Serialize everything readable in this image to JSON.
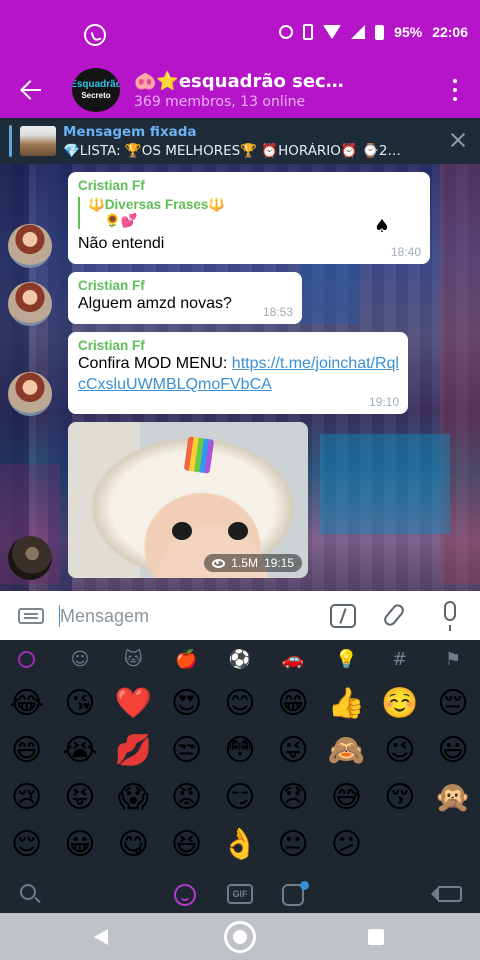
{
  "status_bar": {
    "battery": "95%",
    "time": "22:06"
  },
  "chat": {
    "title": "🐽⭐esquadrão sec…",
    "subtitle": "369 membros, 13 online",
    "avatar_line1": "Esquadrão",
    "avatar_line2": "Secreto"
  },
  "pinned": {
    "title": "Mensagem fixada",
    "text": "💎LISTA: 🏆OS MELHORES🏆 ⏰HORÁRIO⏰ ⌚2…"
  },
  "messages": [
    {
      "sender": "Cristian Ff",
      "reply_name": "🔱Diversas Frases🔱",
      "reply_text": "🌻💕",
      "text": "Não entendi",
      "time": "18:40"
    },
    {
      "sender": "Cristian Ff",
      "text": "Alguem amzd novas?",
      "time": "18:53"
    },
    {
      "sender": "Cristian Ff",
      "text": "Confira MOD MENU: ",
      "link": "https://t.me/joinchat/RqlcCxsluUWMBLQmoFVbCA",
      "time": "19:10"
    },
    {
      "views": "1.5M",
      "time": "19:15"
    }
  ],
  "input": {
    "placeholder": "Mensagem"
  },
  "emoji_tabs": [
    "recent",
    "smileys",
    "animals",
    "food",
    "sports",
    "travel",
    "objects",
    "symbols",
    "flags"
  ],
  "emojis": [
    "😂",
    "😘",
    "❤️",
    "😍",
    "😊",
    "😁",
    "👍",
    "☺️",
    "😔",
    "😄",
    "😭",
    "💋",
    "😒",
    "😳",
    "😜",
    "🙈",
    "😉",
    "😃",
    "😢",
    "😝",
    "😱",
    "😡",
    "😏",
    "😞",
    "😅",
    "😚",
    "🙊",
    "😌",
    "😀",
    "😋",
    "😆",
    "👌",
    "😐",
    "😕"
  ],
  "colors": {
    "header": "#b614c9",
    "panel": "#1e2730",
    "accent": "#9c2eb0",
    "sender_green": "#5fbf57",
    "link_blue": "#3a8fd3"
  }
}
